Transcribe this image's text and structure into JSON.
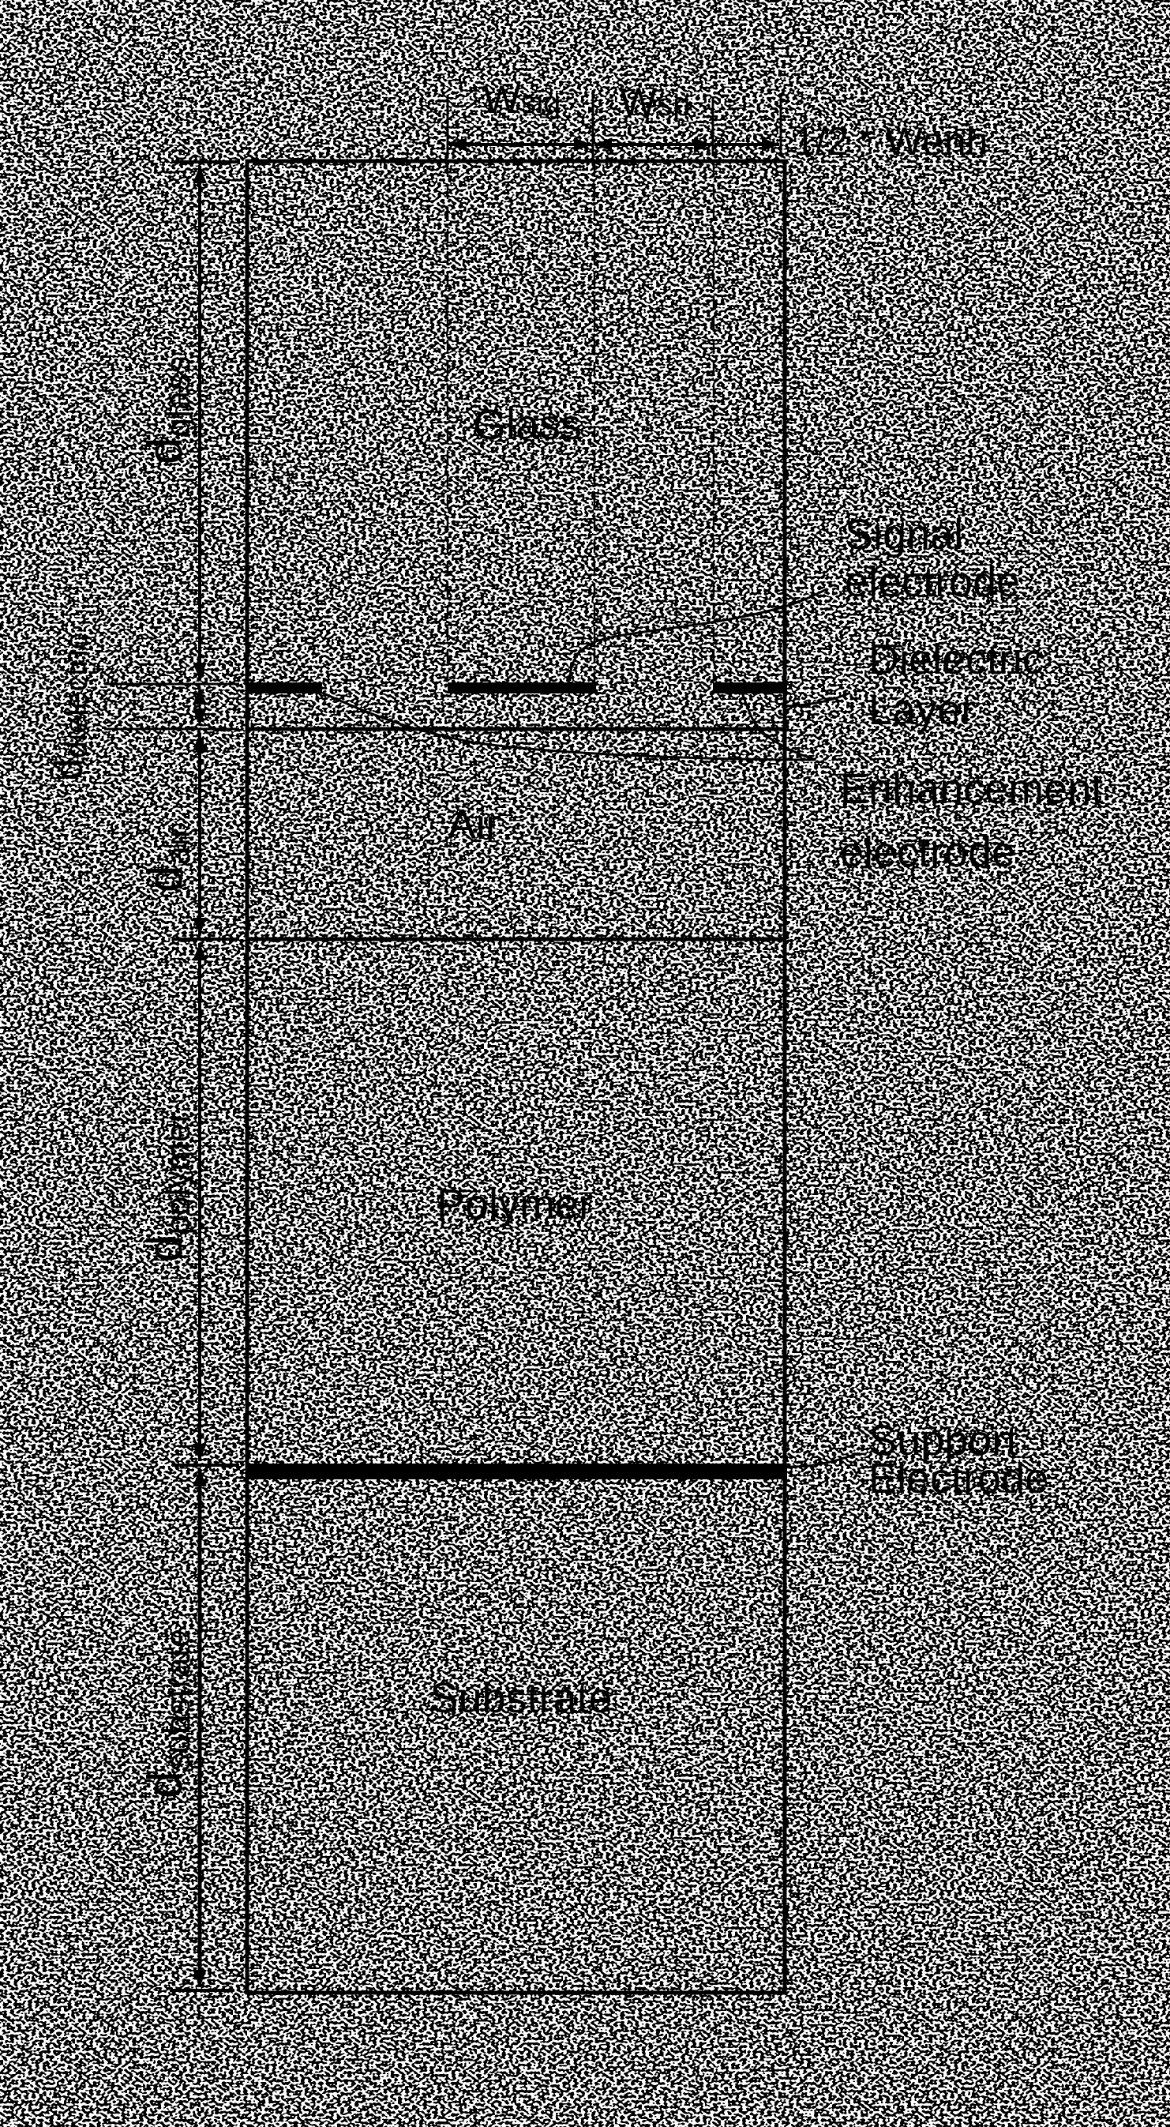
{
  "figure": {
    "layers": [
      {
        "id": "glass",
        "name": "Glass",
        "texture": "dense-labyrinth"
      },
      {
        "id": "dielectric",
        "name": "Dielectric Layer",
        "texture": "dense-labyrinth"
      },
      {
        "id": "air",
        "name": "Air",
        "texture": "sparse-dots"
      },
      {
        "id": "polymer",
        "name": "Polymer",
        "texture": "dense-labyrinth"
      },
      {
        "id": "substrate",
        "name": "Substrate",
        "texture": "medium-speckle"
      }
    ],
    "layer_labels": {
      "glass": "Glass",
      "air": "Air",
      "polymer": "Polymer",
      "substrate": "Substrate"
    },
    "callouts": {
      "signal_electrode": [
        "Signal",
        "electrode"
      ],
      "dielectric_layer": [
        "Dielectric",
        "Layer"
      ],
      "enhancement_electrode": [
        "Enhancement",
        "electrode"
      ],
      "support_electrode": [
        "Support",
        "Electrode"
      ]
    },
    "thickness_dimensions": {
      "glass": {
        "main": "d",
        "sub": "glass"
      },
      "dielectric": {
        "main": "d",
        "sub": "dielectric"
      },
      "air": {
        "main": "d",
        "sub": "air"
      },
      "polymer": {
        "main": "d",
        "sub": "polymer"
      },
      "substrate": {
        "main": "d",
        "sub": "substrate"
      }
    },
    "width_dimensions": {
      "signal": {
        "main": "W",
        "sub": "sig"
      },
      "spacing": {
        "main": "W",
        "sub": "sp"
      },
      "enhancement_half": "1/2 * Wenh"
    },
    "colors": {
      "ink": "#000000",
      "paper": "#ffffff"
    }
  }
}
